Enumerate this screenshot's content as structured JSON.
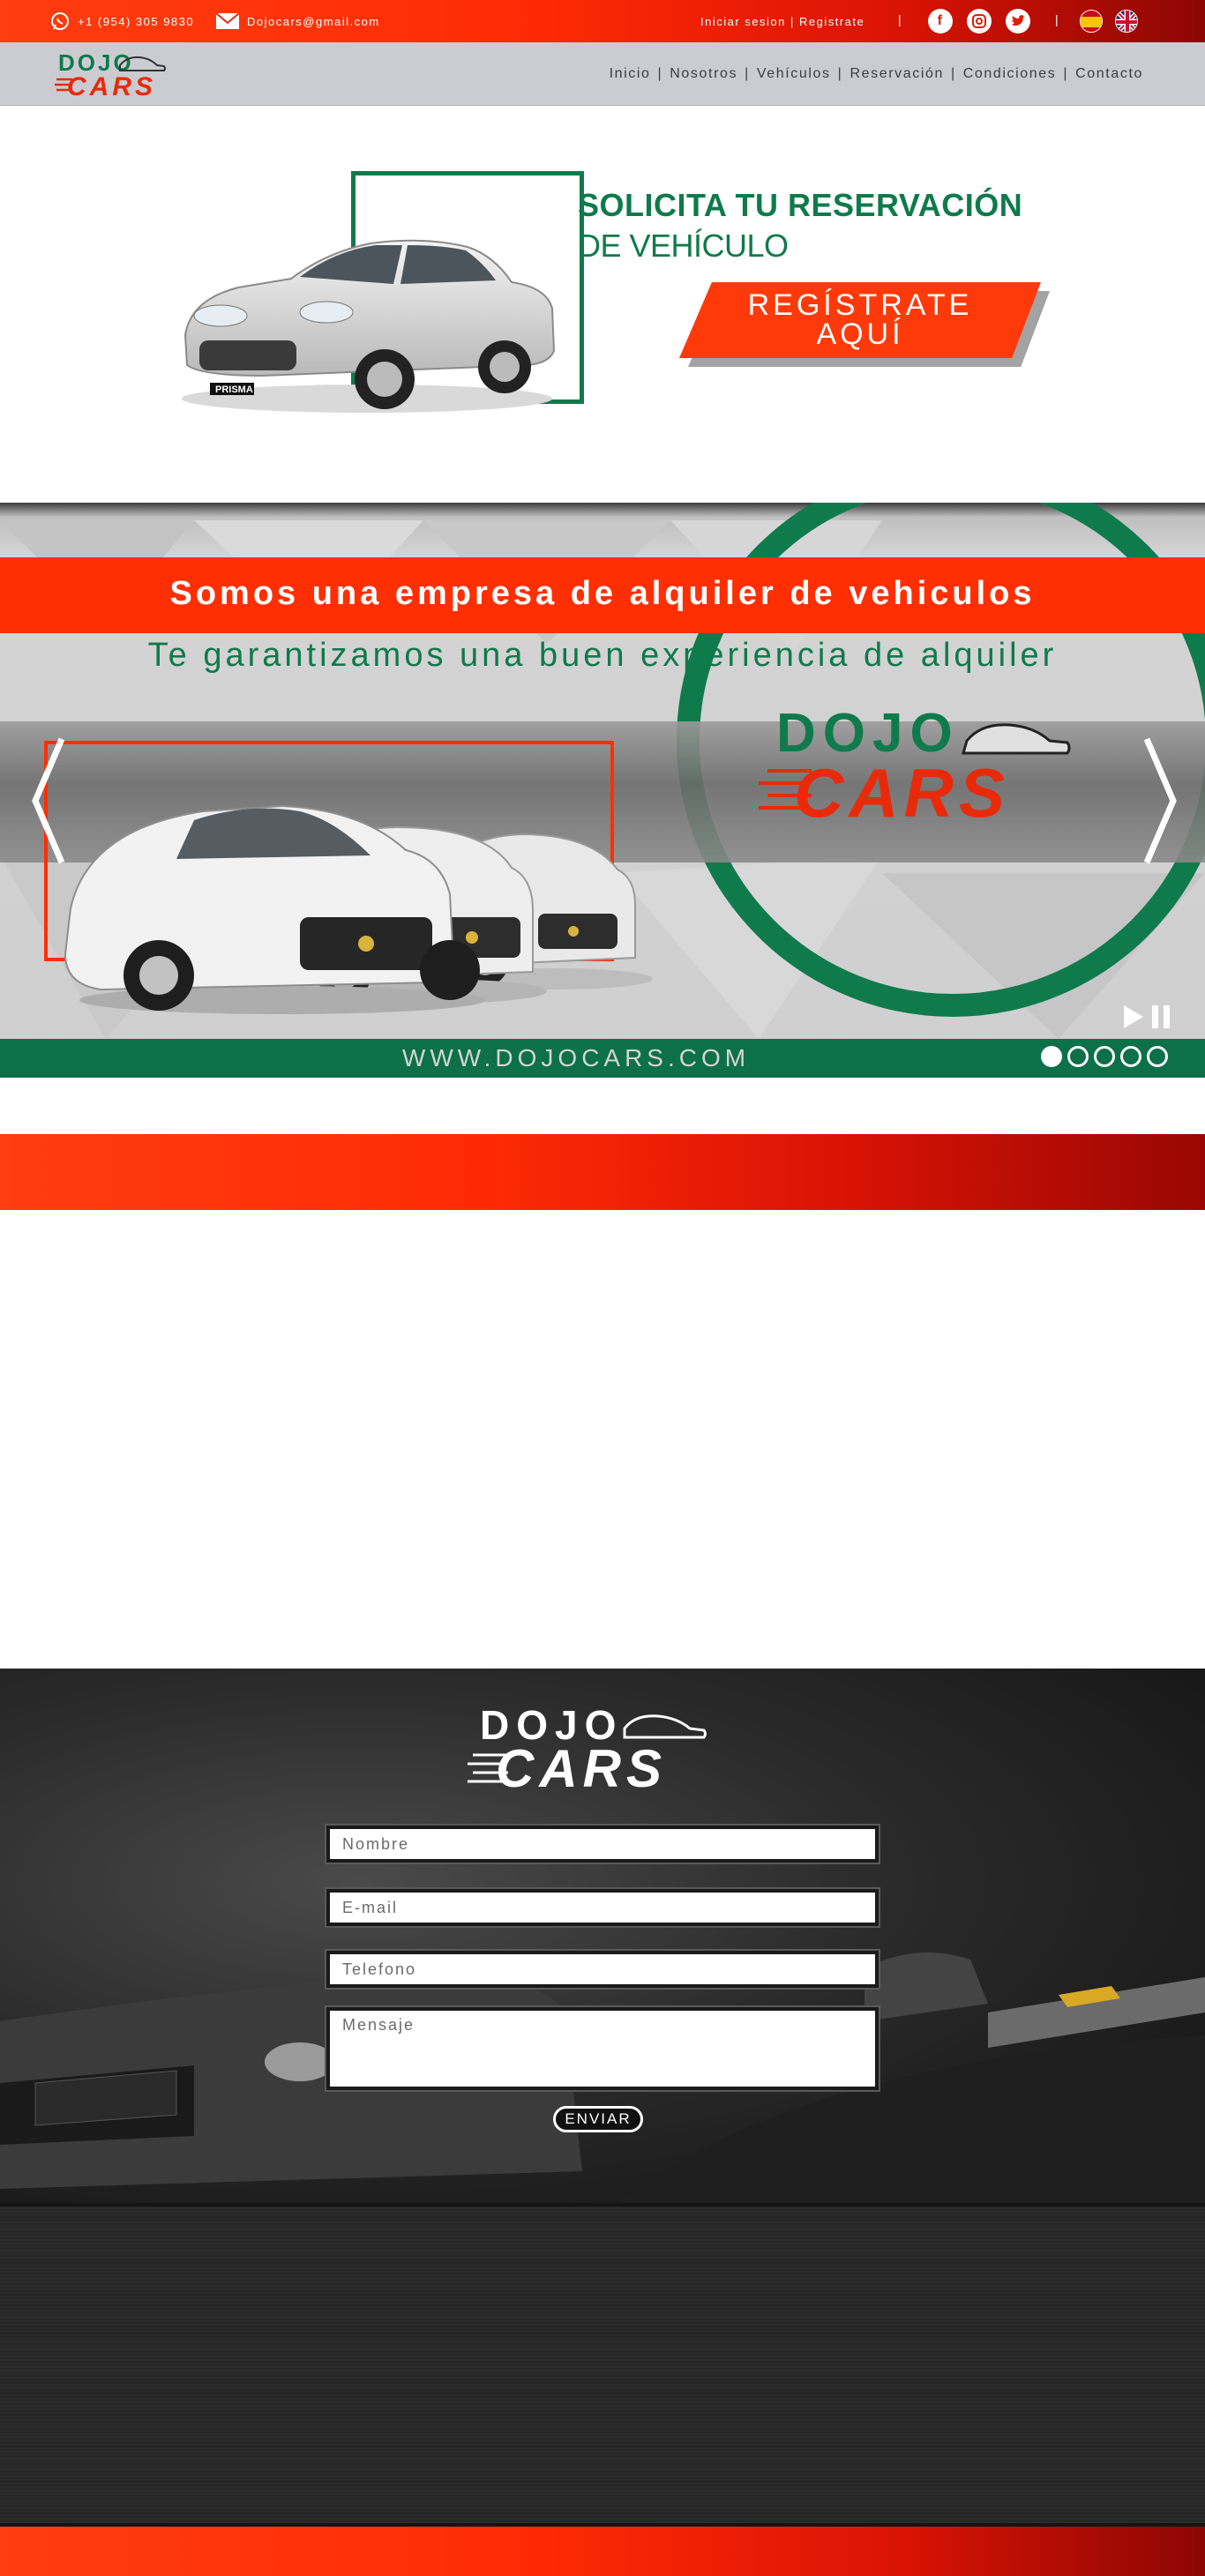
{
  "topbar": {
    "phone": "+1 (954) 305 9830",
    "email": "Dojocars@gmail.com",
    "auth": "Iniciar sesion | Registrate",
    "social": [
      "facebook-icon",
      "instagram-icon",
      "twitter-icon"
    ],
    "languages": [
      "spain-flag-icon",
      "uk-flag-icon"
    ],
    "divider": "|"
  },
  "logo": {
    "top": "DOJO",
    "bottom": "CARS"
  },
  "nav": {
    "items": [
      "Inicio",
      "Nosotros",
      "Vehículos",
      "Reservación",
      "Condiciones",
      "Contacto"
    ],
    "separator": "|"
  },
  "promo": {
    "title_line1": "SOLICITA TU RESERVACIÓN",
    "title_line2": "DE VEHÍCULO",
    "cta_line1": "REGÍSTRATE",
    "cta_line2": "AQUÍ",
    "car_badge": "PRISMA"
  },
  "slider": {
    "headline": "Somos una empresa de alquiler de vehiculos",
    "tagline": "Te garantizamos una buen experiencia de alquiler",
    "website": "WWW.DOJOCARS.COM",
    "slide_count": 5,
    "active_slide": 1
  },
  "contact": {
    "name_placeholder": "Nombre",
    "email_placeholder": "E-mail",
    "phone_placeholder": "Telefono",
    "message_placeholder": "Mensaje",
    "send_label": "ENVIAR"
  },
  "colors": {
    "brand_red": "#ff2f03",
    "brand_green": "#0f7a4c",
    "nav_bg": "#cbccd2"
  }
}
